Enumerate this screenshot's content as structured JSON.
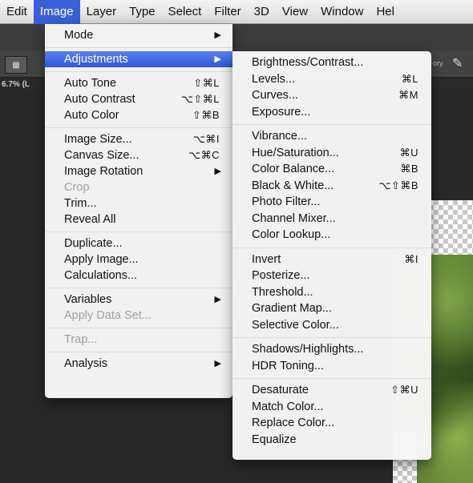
{
  "menubar": {
    "items": [
      "Edit",
      "Image",
      "Layer",
      "Type",
      "Select",
      "Filter",
      "3D",
      "View",
      "Window",
      "Hel"
    ],
    "active_index": 1,
    "active_color": "#3b5fd6"
  },
  "app": {
    "zoom_label": "6.7% (L",
    "right_strip_label": "ory"
  },
  "image_menu": {
    "groups": [
      [
        {
          "label": "Mode",
          "shortcut": "",
          "submenu": true,
          "disabled": false
        }
      ],
      [
        {
          "label": "Adjustments",
          "shortcut": "",
          "submenu": true,
          "disabled": false,
          "highlight": true
        }
      ],
      [
        {
          "label": "Auto Tone",
          "shortcut": "⇧⌘L",
          "submenu": false,
          "disabled": false
        },
        {
          "label": "Auto Contrast",
          "shortcut": "⌥⇧⌘L",
          "submenu": false,
          "disabled": false
        },
        {
          "label": "Auto Color",
          "shortcut": "⇧⌘B",
          "submenu": false,
          "disabled": false
        }
      ],
      [
        {
          "label": "Image Size...",
          "shortcut": "⌥⌘I",
          "submenu": false,
          "disabled": false
        },
        {
          "label": "Canvas Size...",
          "shortcut": "⌥⌘C",
          "submenu": false,
          "disabled": false
        },
        {
          "label": "Image Rotation",
          "shortcut": "",
          "submenu": true,
          "disabled": false
        },
        {
          "label": "Crop",
          "shortcut": "",
          "submenu": false,
          "disabled": true
        },
        {
          "label": "Trim...",
          "shortcut": "",
          "submenu": false,
          "disabled": false
        },
        {
          "label": "Reveal All",
          "shortcut": "",
          "submenu": false,
          "disabled": false
        }
      ],
      [
        {
          "label": "Duplicate...",
          "shortcut": "",
          "submenu": false,
          "disabled": false
        },
        {
          "label": "Apply Image...",
          "shortcut": "",
          "submenu": false,
          "disabled": false
        },
        {
          "label": "Calculations...",
          "shortcut": "",
          "submenu": false,
          "disabled": false
        }
      ],
      [
        {
          "label": "Variables",
          "shortcut": "",
          "submenu": true,
          "disabled": false
        },
        {
          "label": "Apply Data Set...",
          "shortcut": "",
          "submenu": false,
          "disabled": true
        }
      ],
      [
        {
          "label": "Trap...",
          "shortcut": "",
          "submenu": false,
          "disabled": true
        }
      ],
      [
        {
          "label": "Analysis",
          "shortcut": "",
          "submenu": true,
          "disabled": false
        }
      ]
    ]
  },
  "adjustments_menu": {
    "groups": [
      [
        {
          "label": "Brightness/Contrast...",
          "shortcut": ""
        },
        {
          "label": "Levels...",
          "shortcut": "⌘L"
        },
        {
          "label": "Curves...",
          "shortcut": "⌘M"
        },
        {
          "label": "Exposure...",
          "shortcut": ""
        }
      ],
      [
        {
          "label": "Vibrance...",
          "shortcut": ""
        },
        {
          "label": "Hue/Saturation...",
          "shortcut": "⌘U"
        },
        {
          "label": "Color Balance...",
          "shortcut": "⌘B"
        },
        {
          "label": "Black & White...",
          "shortcut": "⌥⇧⌘B"
        },
        {
          "label": "Photo Filter...",
          "shortcut": ""
        },
        {
          "label": "Channel Mixer...",
          "shortcut": ""
        },
        {
          "label": "Color Lookup...",
          "shortcut": ""
        }
      ],
      [
        {
          "label": "Invert",
          "shortcut": "⌘I"
        },
        {
          "label": "Posterize...",
          "shortcut": ""
        },
        {
          "label": "Threshold...",
          "shortcut": ""
        },
        {
          "label": "Gradient Map...",
          "shortcut": ""
        },
        {
          "label": "Selective Color...",
          "shortcut": ""
        }
      ],
      [
        {
          "label": "Shadows/Highlights...",
          "shortcut": ""
        },
        {
          "label": "HDR Toning...",
          "shortcut": ""
        }
      ],
      [
        {
          "label": "Desaturate",
          "shortcut": "⇧⌘U"
        },
        {
          "label": "Match Color...",
          "shortcut": ""
        },
        {
          "label": "Replace Color...",
          "shortcut": ""
        },
        {
          "label": "Equalize",
          "shortcut": ""
        }
      ]
    ]
  },
  "icons": {
    "submenu_arrow": "▶",
    "brush": "brush-icon"
  }
}
